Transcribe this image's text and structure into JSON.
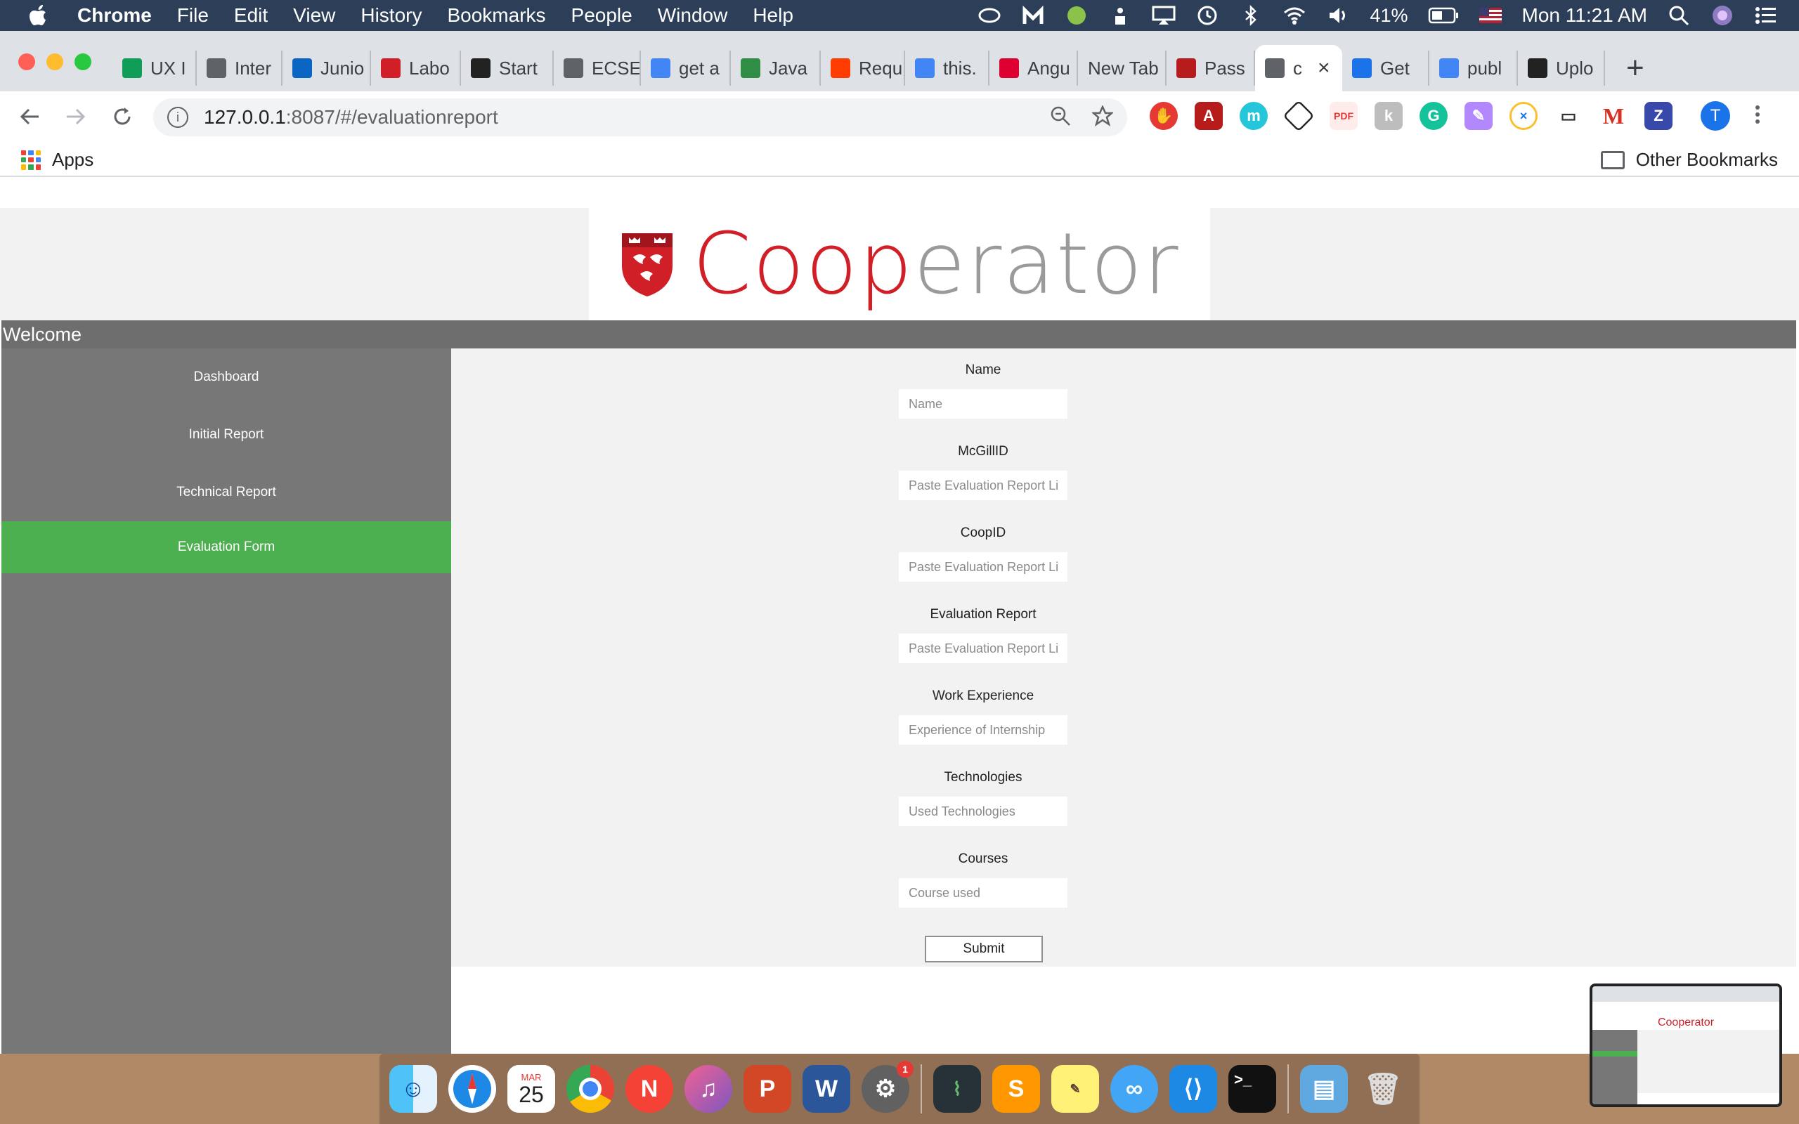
{
  "menubar": {
    "app_name": "Chrome",
    "menus": [
      "File",
      "Edit",
      "View",
      "History",
      "Bookmarks",
      "People",
      "Window",
      "Help"
    ],
    "battery": "41%",
    "clock": "Mon 11:21 AM"
  },
  "tabs": [
    {
      "label": "UX I",
      "icon": "green-doc-icon",
      "color": "#0f9d58"
    },
    {
      "label": "Inter",
      "icon": "t-circle-icon",
      "color": "#5f6368"
    },
    {
      "label": "Junio",
      "icon": "linkedin-icon",
      "color": "#0a66c2"
    },
    {
      "label": "Labo",
      "icon": "mcgill-icon",
      "color": "#d11f28"
    },
    {
      "label": "Start",
      "icon": "crown-icon",
      "color": "#222222"
    },
    {
      "label": "ECSE",
      "icon": "doc-icon",
      "color": "#5f6368"
    },
    {
      "label": "get a",
      "icon": "google-icon",
      "color": "#4285f4"
    },
    {
      "label": "Java",
      "icon": "gfg-icon",
      "color": "#2f8d46"
    },
    {
      "label": "Requ",
      "icon": "red-app-icon",
      "color": "#ff3d00"
    },
    {
      "label": "this.",
      "icon": "google-icon",
      "color": "#4285f4"
    },
    {
      "label": "Angu",
      "icon": "angular-icon",
      "color": "#dd0031"
    },
    {
      "label": "New Tab",
      "icon": "",
      "color": ""
    },
    {
      "label": "Pass",
      "icon": "mail-icon",
      "color": "#b71c1c"
    },
    {
      "label": "c",
      "icon": "doc-icon",
      "color": "#5f6368",
      "active": true
    },
    {
      "label": "Get",
      "icon": "send-icon",
      "color": "#1a73e8"
    },
    {
      "label": "publ",
      "icon": "google-icon",
      "color": "#4285f4"
    },
    {
      "label": "Uplo",
      "icon": "github-icon",
      "color": "#222222"
    }
  ],
  "address": {
    "host": "127.0.0.1",
    "path": ":8087/#/evaluationreport"
  },
  "profile_initial": "T",
  "bookmarks": {
    "apps_label": "Apps",
    "other_label": "Other Bookmarks"
  },
  "site": {
    "logo_red": "Coop",
    "logo_gray": "erator",
    "welcome": "Welcome"
  },
  "sidebar": {
    "items": [
      {
        "label": "Dashboard"
      },
      {
        "label": "Initial Report"
      },
      {
        "label": "Technical Report"
      },
      {
        "label": "Evaluation Form",
        "active": true
      }
    ]
  },
  "form": {
    "fields": [
      {
        "label": "Name",
        "placeholder": "Name",
        "value": ""
      },
      {
        "label": "McGillID",
        "placeholder": "Paste Evaluation Report Li",
        "value": ""
      },
      {
        "label": "CoopID",
        "placeholder": "Paste Evaluation Report Li",
        "value": ""
      },
      {
        "label": "Evaluation Report",
        "placeholder": "Paste Evaluation Report Li",
        "value": ""
      },
      {
        "label": "Work Experience",
        "placeholder": "Experience of Internship",
        "value": ""
      },
      {
        "label": "Technologies",
        "placeholder": "Used Technologies",
        "value": ""
      },
      {
        "label": "Courses",
        "placeholder": "Course used",
        "value": ""
      }
    ],
    "submit_label": "Submit"
  },
  "dock": {
    "calendar_month": "MAR",
    "calendar_day": "25",
    "settings_badge": "1"
  },
  "thumbnail": {
    "logo": "Cooperator"
  },
  "colors": {
    "accent_green": "#4caf50",
    "sidebar_gray": "#777777",
    "logo_red": "#d11f28",
    "logo_gray": "#9a9a9a"
  }
}
